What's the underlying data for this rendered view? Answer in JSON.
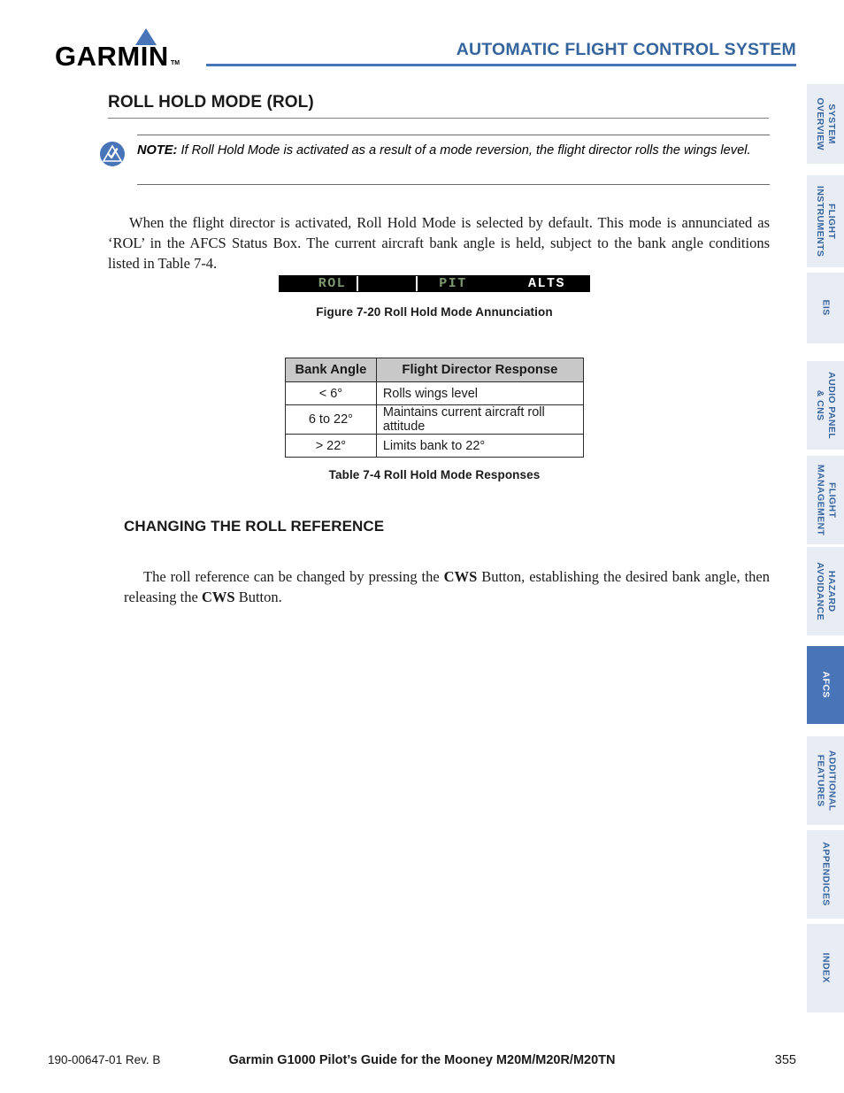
{
  "header": {
    "logo_text": "GARMIN",
    "logo_tm": "TM",
    "title": "AUTOMATIC FLIGHT CONTROL SYSTEM",
    "accent_color": "#4874b8",
    "title_color": "#36659e"
  },
  "section": {
    "heading": "ROLL HOLD MODE (ROL)"
  },
  "note": {
    "label": "NOTE:",
    "text": " If Roll Hold Mode is activated as a result of a mode reversion, the flight director rolls the wings level.",
    "icon": "note-caution-icon"
  },
  "paragraphs": {
    "intro": "When the flight director is activated, Roll Hold Mode is selected by default.  This mode is annunciated as ‘ROL’ in the AFCS Status Box.  The current aircraft bank angle is held, subject to the bank angle conditions listed in Table 7-4.",
    "changing_ref_1": "The roll reference can be changed by pressing the ",
    "changing_ref_cws_1": "CWS",
    "changing_ref_2": " Button, establishing the desired bank angle, then releasing the ",
    "changing_ref_cws_2": "CWS",
    "changing_ref_3": " Button."
  },
  "annunciation": {
    "roll_mode": "ROL",
    "pitch_mode": "PIT",
    "altitude_mode": "ALTS",
    "active_color": "#7d9a72",
    "armed_color": "#ffffff",
    "background_color": "#000000"
  },
  "figure_caption": "Figure 7-20  Roll Hold Mode Annunciation",
  "table": {
    "caption": "Table 7-4  Roll Hold Mode Responses",
    "headers": [
      "Bank Angle",
      "Flight Director Response"
    ],
    "rows": [
      [
        "< 6°",
        "Rolls wings level"
      ],
      [
        "6 to 22°",
        "Maintains current aircraft roll attitude"
      ],
      [
        "> 22°",
        "Limits bank to 22°"
      ]
    ]
  },
  "subsection": {
    "heading": "CHANGING THE ROLL REFERENCE"
  },
  "sidebar": {
    "tabs": [
      {
        "label": "SYSTEM\nOVERVIEW",
        "active": false
      },
      {
        "label": "FLIGHT\nINSTRUMENTS",
        "active": false
      },
      {
        "label": "EIS",
        "active": false
      },
      {
        "label": "AUDIO PANEL\n& CNS",
        "active": false
      },
      {
        "label": "FLIGHT\nMANAGEMENT",
        "active": false
      },
      {
        "label": "HAZARD\nAVOIDANCE",
        "active": false
      },
      {
        "label": "AFCS",
        "active": true
      },
      {
        "label": "ADDITIONAL\nFEATURES",
        "active": false
      },
      {
        "label": "APPENDICES",
        "active": false
      },
      {
        "label": "INDEX",
        "active": false
      }
    ],
    "active_background": "#4874b8",
    "inactive_background": "#e8ecf5"
  },
  "footer": {
    "left": "190-00647-01  Rev. B",
    "center": "Garmin G1000 Pilot’s Guide for the Mooney M20M/M20R/M20TN",
    "page_number": "355"
  }
}
